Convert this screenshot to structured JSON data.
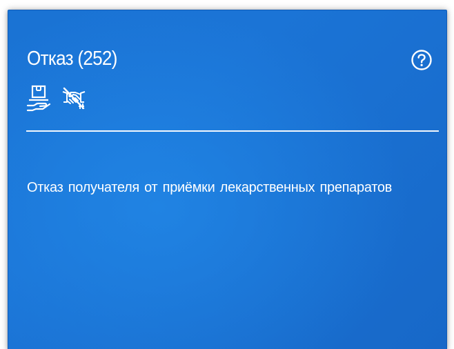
{
  "card": {
    "title": "Отказ (252)",
    "description": "Отказ получателя от приёмки лекарственных препаратов",
    "background_color": "#1b74d6",
    "text_color": "#ffffff",
    "icons": [
      "hand-box-icon",
      "crossed-handshake-icon"
    ],
    "help_icon": "question-circle-icon"
  }
}
